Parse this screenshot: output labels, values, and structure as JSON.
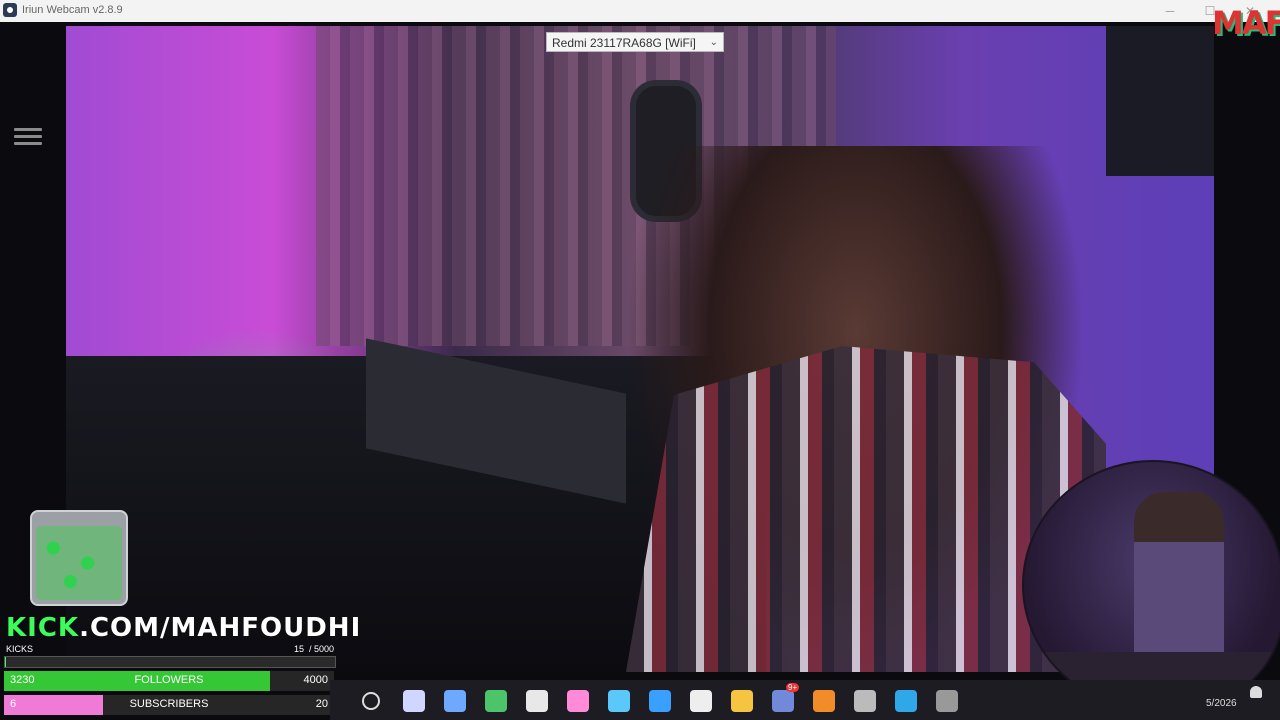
{
  "window": {
    "title": "Iriun Webcam v2.8.9",
    "minimize": "─",
    "maximize": "☐",
    "close": "✕"
  },
  "device": {
    "selected": "Redmi 23117RA68G [WiFi]"
  },
  "overlay": {
    "logo": "MAF",
    "kick_brand": "KICK",
    "kick_domain": ".COM/MAHFOUDHI",
    "kicks": {
      "label": "KICKS",
      "count": "15",
      "goal": "/ 5000",
      "fraction": 0.003
    },
    "followers": {
      "label": "FOLLOWERS",
      "current": "3230",
      "goal": "4000",
      "fraction": 0.8075,
      "color": "#35c735"
    },
    "subscribers": {
      "label": "SUBSCRIBERS",
      "current": "6",
      "goal": "20",
      "fraction": 0.3,
      "color": "#f07bd6"
    }
  },
  "taskbar": {
    "icons": [
      "search-icon",
      "task-view-icon",
      "network-icon",
      "android-icon",
      "webcam-icon",
      "copilot-icon",
      "store-icon",
      "vscode-icon",
      "capcut-icon",
      "folder-icon",
      "discord-icon",
      "fl-studio-icon",
      "obs-icon",
      "edge-icon",
      "keyboard-icon"
    ],
    "badge": "9+",
    "clock_date": "5/2026"
  },
  "colors": {
    "kick_green": "#3dfc5a",
    "menu_gray": "#8b8b8b"
  }
}
